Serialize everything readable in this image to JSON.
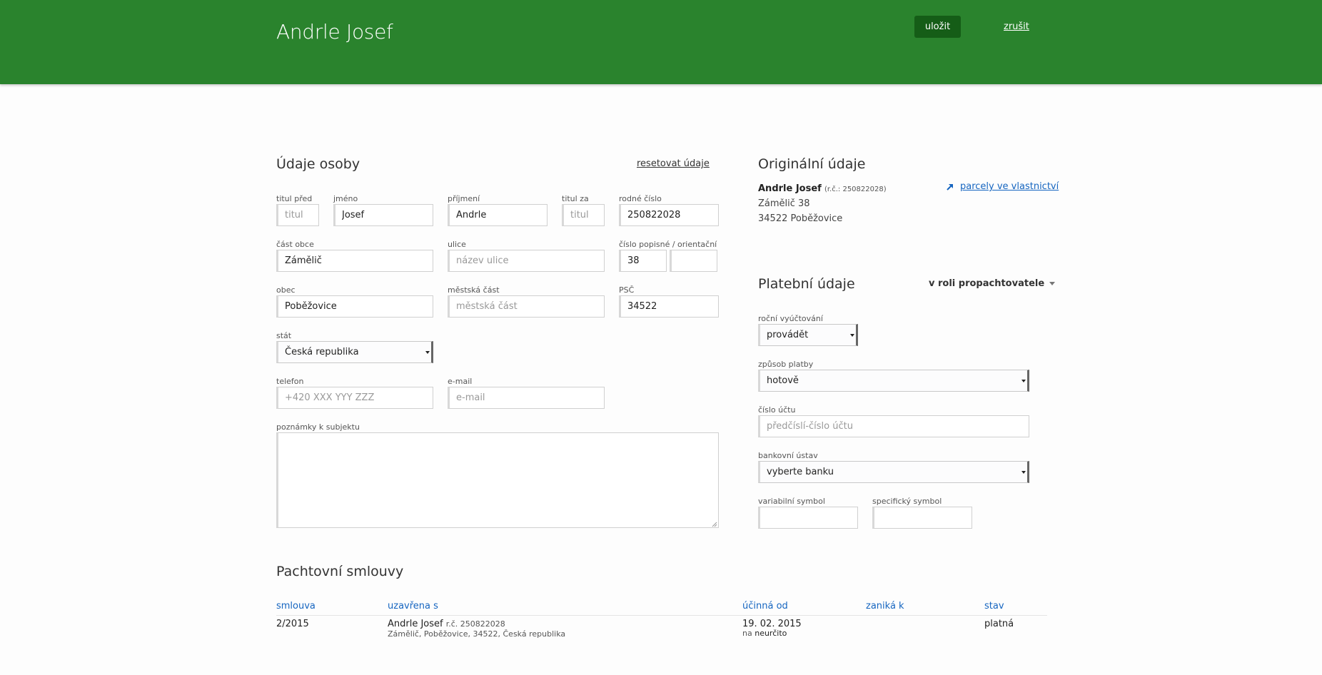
{
  "header": {
    "title": "Andrle Josef",
    "save_label": "uložit",
    "cancel_label": "zrušit"
  },
  "person": {
    "section_title": "Údaje osoby",
    "reset_label": "resetovat údaje",
    "fields": {
      "title_before": {
        "label": "titul před",
        "value": "",
        "placeholder": "titul"
      },
      "first_name": {
        "label": "jméno",
        "value": "Josef",
        "placeholder": ""
      },
      "surname": {
        "label": "příjmení",
        "value": "Andrle",
        "placeholder": ""
      },
      "title_after": {
        "label": "titul za",
        "value": "",
        "placeholder": "titul"
      },
      "birth_number": {
        "label": "rodné číslo",
        "value": "250822028",
        "placeholder": ""
      },
      "district": {
        "label": "část obce",
        "value": "Zámělič",
        "placeholder": ""
      },
      "street": {
        "label": "ulice",
        "value": "",
        "placeholder": "název ulice"
      },
      "house_number": {
        "label": "číslo popisné / orientační",
        "value": "38",
        "placeholder": ""
      },
      "orientation_number": {
        "value": "",
        "placeholder": ""
      },
      "municipality": {
        "label": "obec",
        "value": "Poběžovice",
        "placeholder": ""
      },
      "city_part": {
        "label": "městská část",
        "value": "",
        "placeholder": "městská část"
      },
      "zip": {
        "label": "PSČ",
        "value": "34522",
        "placeholder": ""
      },
      "country": {
        "label": "stát",
        "value": "Česká republika"
      },
      "phone": {
        "label": "telefon",
        "value": "",
        "placeholder": "+420 XXX YYY ZZZ"
      },
      "email": {
        "label": "e-mail",
        "value": "",
        "placeholder": "e-mail"
      },
      "notes": {
        "label": "poznámky k subjektu",
        "value": ""
      }
    }
  },
  "original": {
    "section_title": "Originální údaje",
    "name": "Andrle Josef",
    "birth_ref": "(r.č.: 250822028)",
    "street": "Zámělič 38",
    "city": "34522 Poběžovice",
    "parcels_link": "parcely ve vlastnictví"
  },
  "payment": {
    "section_title": "Platební údaje",
    "role_label": "v roli propachtovatele",
    "fields": {
      "annual_billing": {
        "label": "roční vyúčtování",
        "value": "provádět"
      },
      "payment_method": {
        "label": "způsob platby",
        "value": "hotově"
      },
      "account_number": {
        "label": "číslo účtu",
        "value": "",
        "placeholder": "předčíslí-číslo účtu"
      },
      "bank": {
        "label": "bankovní ústav",
        "value": "vyberte banku"
      },
      "variable_symbol": {
        "label": "variabilní symbol",
        "value": ""
      },
      "specific_symbol": {
        "label": "specifický symbol",
        "value": ""
      }
    }
  },
  "contracts": {
    "section_title": "Pachtovní smlouvy",
    "columns": [
      "smlouva",
      "uzavřena s",
      "účinná od",
      "zaniká k",
      "stav"
    ],
    "rows": [
      {
        "contract": "2/2015",
        "party_name": "Andrle Josef",
        "party_ref": "r.č. 250822028",
        "party_address": "Zámělič, Poběžovice, 34522, Česká republika",
        "effective_from": "19. 02. 2015",
        "duration_prefix": "na",
        "duration": "neurčito",
        "ends": "",
        "status": "platná"
      }
    ]
  },
  "colors": {
    "header_bg": "#2a832d",
    "save_button_bg": "#155d17",
    "link_blue": "#1565c0"
  }
}
